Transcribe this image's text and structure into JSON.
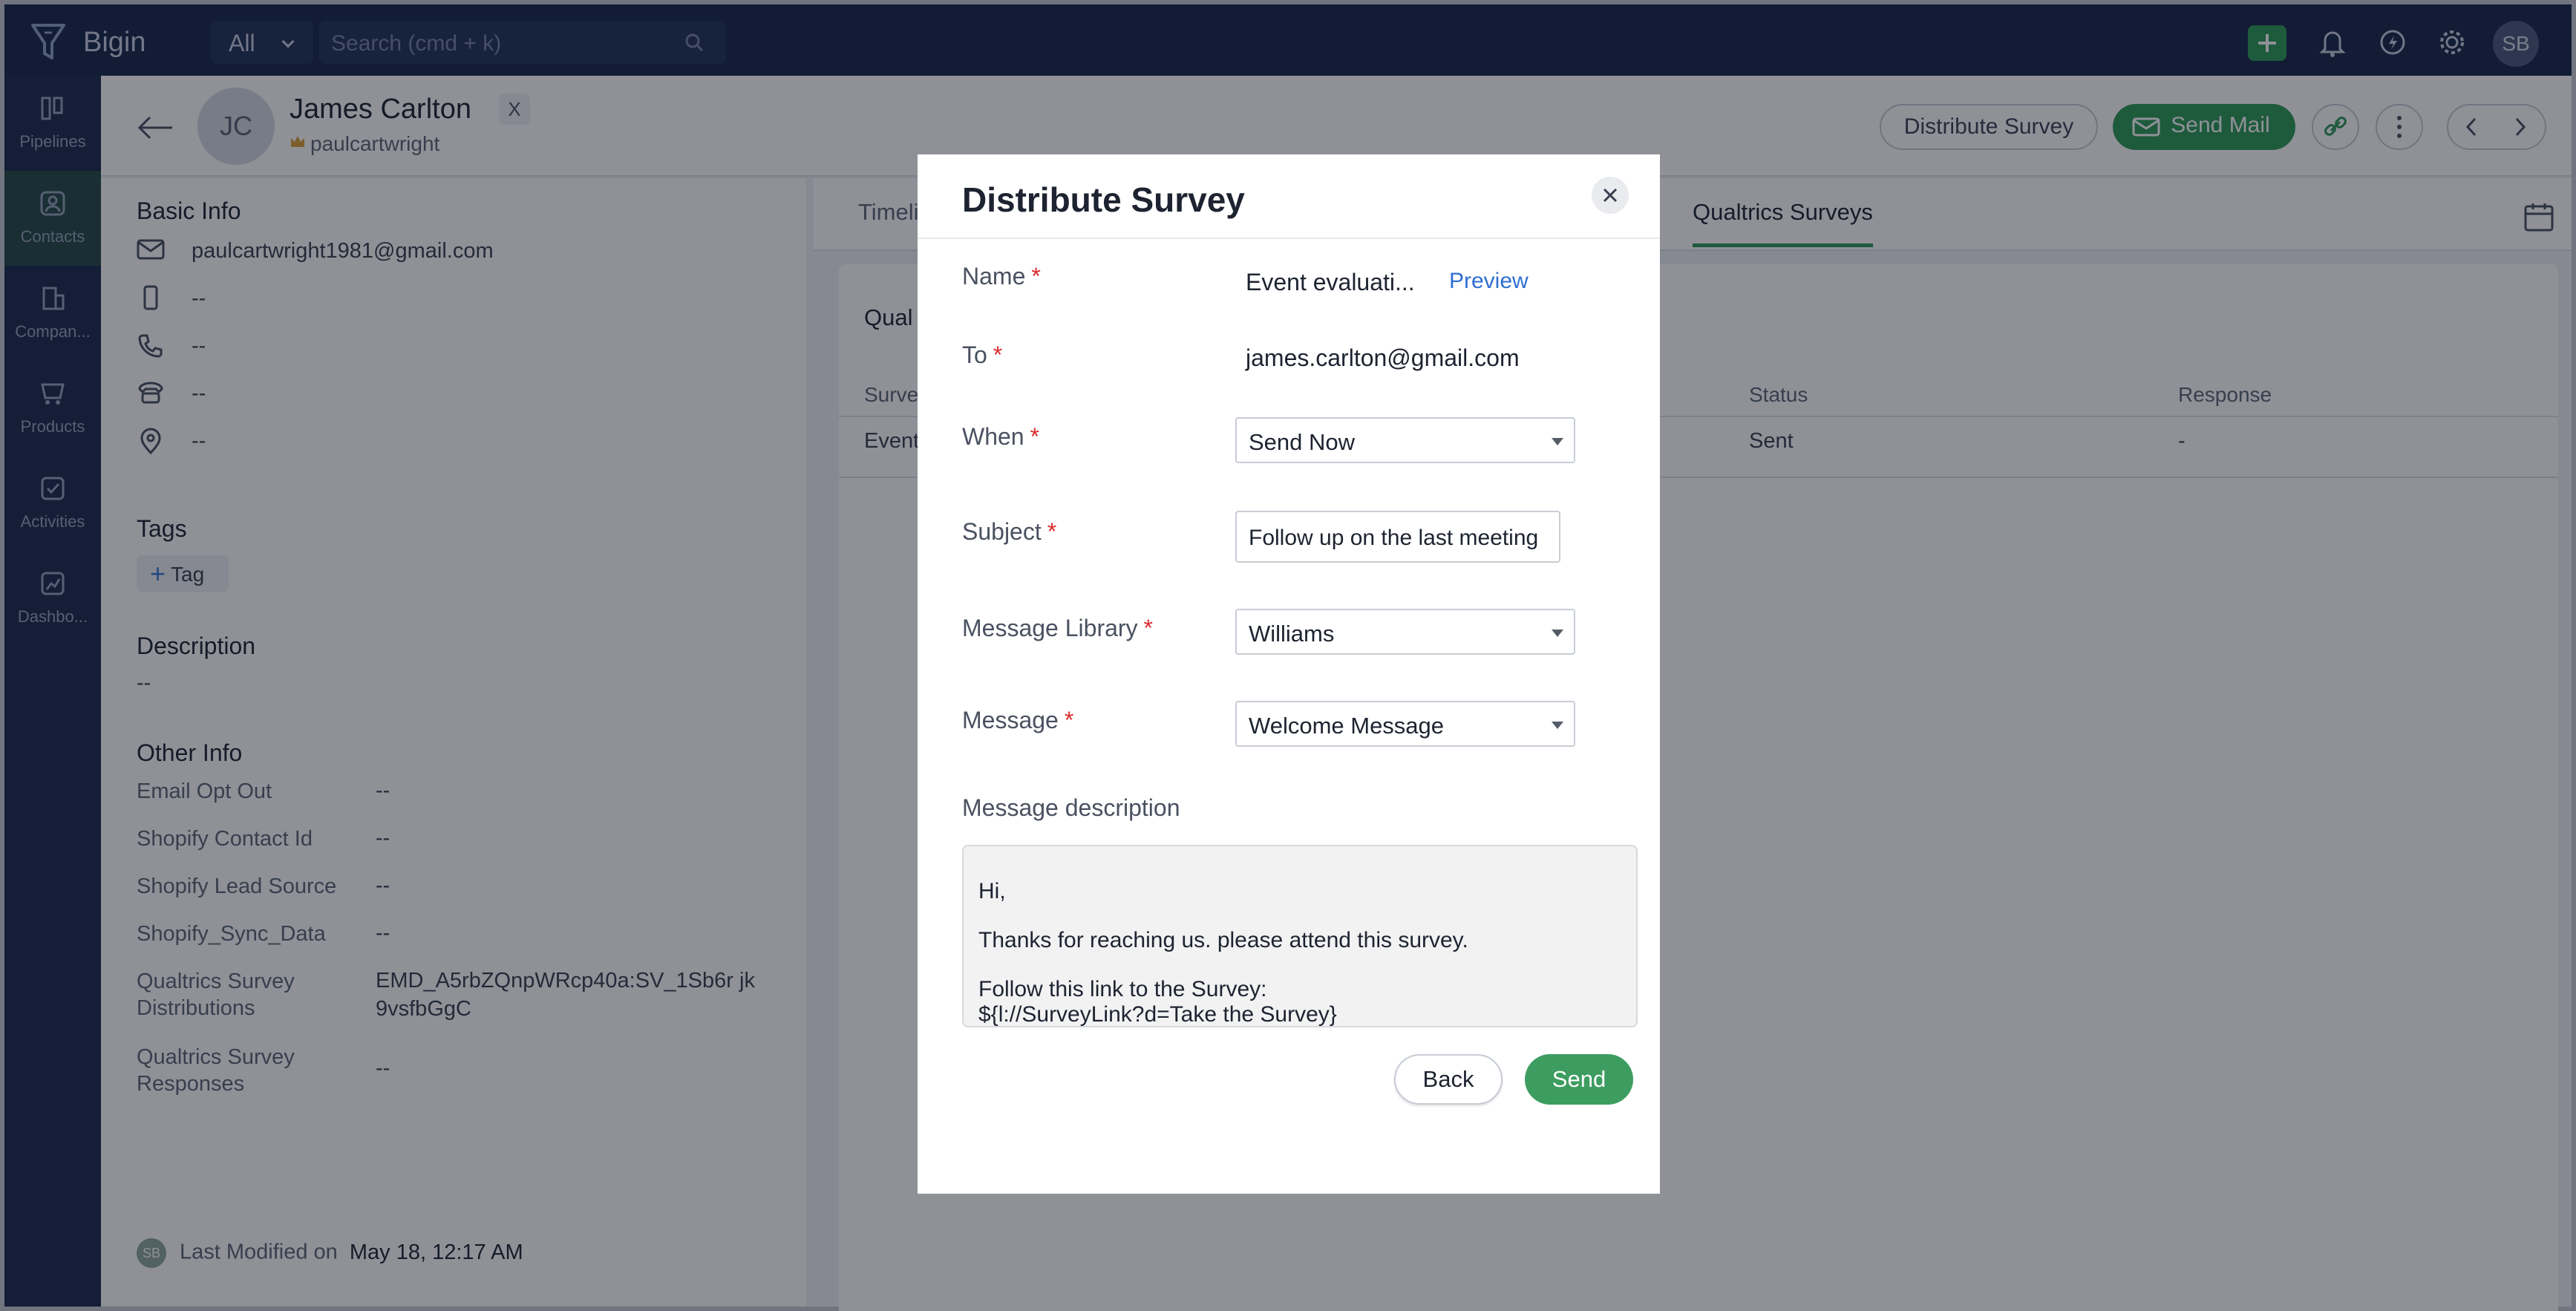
{
  "app": {
    "name": "Bigin"
  },
  "topbar": {
    "scope": "All",
    "search_placeholder": "Search (cmd + k)",
    "user_initials": "SB",
    "plus_color": "#2f9a57"
  },
  "nav": {
    "items": [
      {
        "label": "Pipelines",
        "icon": "pipelines-icon"
      },
      {
        "label": "Contacts",
        "icon": "contacts-icon"
      },
      {
        "label": "Compan...",
        "icon": "companies-icon"
      },
      {
        "label": "Products",
        "icon": "products-icon"
      },
      {
        "label": "Activities",
        "icon": "activities-icon"
      },
      {
        "label": "Dashbo...",
        "icon": "dashboards-icon"
      }
    ]
  },
  "contact": {
    "initials": "JC",
    "name": "James Carlton",
    "owner": "paulcartwright",
    "x_label": "X"
  },
  "header_buttons": {
    "distribute": "Distribute Survey",
    "send_mail": "Send Mail"
  },
  "basic_info": {
    "title": "Basic Info",
    "email": "paulcartwright1981@gmail.com",
    "mobile": "--",
    "phone": "--",
    "home_phone": "--",
    "address": "--"
  },
  "tags": {
    "title": "Tags",
    "add_label": "Tag"
  },
  "description": {
    "title": "Description",
    "value": "--"
  },
  "other_info": {
    "title": "Other Info",
    "rows": [
      {
        "label": "Email Opt Out",
        "value": "--"
      },
      {
        "label": "Shopify Contact Id",
        "value": "--"
      },
      {
        "label": "Shopify Lead Source",
        "value": "--"
      },
      {
        "label": "Shopify_Sync_Data",
        "value": "--"
      },
      {
        "label": "Qualtrics Survey Distributions",
        "value": "EMD_A5rbZQnpWRcp40a:SV_1Sb6r jk9vsfbGgC"
      },
      {
        "label": "Qualtrics Survey Responses",
        "value": "--"
      }
    ]
  },
  "modified": {
    "chip": "SB",
    "label": "Last Modified on",
    "value": "May 18, 12:17 AM"
  },
  "tabs": {
    "first": "Timeli",
    "active": "Qualtrics Surveys"
  },
  "card": {
    "title": "Qual",
    "columns": {
      "survey": "Surve",
      "status": "Status",
      "response": "Response"
    },
    "row": {
      "survey": "Event",
      "status": "Sent",
      "response": "-"
    }
  },
  "modal": {
    "title": "Distribute Survey",
    "name_label": "Name",
    "name_value": "Event evaluati...",
    "preview_link": "Preview",
    "to_label": "To",
    "to_value": "james.carlton@gmail.com",
    "when_label": "When",
    "when_value": "Send Now",
    "subject_label": "Subject",
    "subject_value": "Follow up on the last meeting",
    "library_label": "Message Library",
    "library_value": "Williams",
    "message_label": "Message",
    "message_value": "Welcome Message",
    "desc_label": "Message description",
    "desc_lines": [
      "Hi,",
      "Thanks for reaching us. please attend this survey.",
      "Follow this link to the Survey:",
      "${l://SurveyLink?d=Take the Survey}"
    ],
    "required_mark": "*",
    "back_label": "Back",
    "send_label": "Send"
  }
}
